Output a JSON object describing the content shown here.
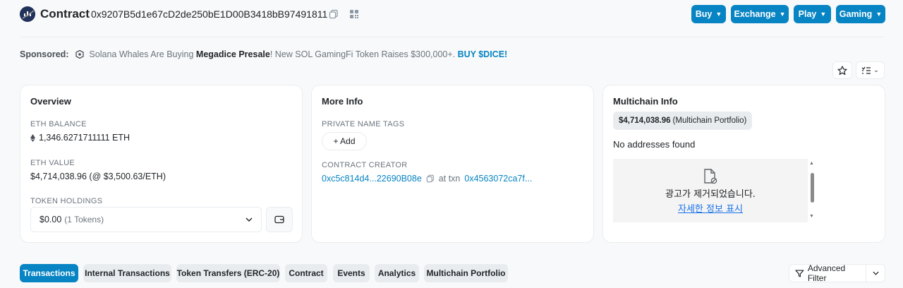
{
  "header": {
    "title": "Contract",
    "address": "0x9207B5d1e67cD2de250bE1D00B3418bB97491811",
    "buttons": [
      {
        "label": "Buy"
      },
      {
        "label": "Exchange"
      },
      {
        "label": "Play"
      },
      {
        "label": "Gaming"
      }
    ]
  },
  "sponsored": {
    "label": "Sponsored:",
    "text_before": "Solana Whales Are Buying ",
    "text_bold": "Megadice Presale",
    "text_after": "! New SOL GamingFi Token Raises $300,000+. ",
    "cta": "BUY $DICE!"
  },
  "overview": {
    "title": "Overview",
    "eth_balance_label": "ETH BALANCE",
    "eth_balance_value": "1,346.6271711111 ETH",
    "eth_value_label": "ETH VALUE",
    "eth_value_value": "$4,714,038.96 (@ $3,500.63/ETH)",
    "token_holdings_label": "TOKEN HOLDINGS",
    "token_holdings_value": "$0.00",
    "token_holdings_count": "(1 Tokens)"
  },
  "more_info": {
    "title": "More Info",
    "private_tags_label": "PRIVATE NAME TAGS",
    "add_label": "+ Add",
    "creator_label": "CONTRACT CREATOR",
    "creator_address": "0xc5c814d4...22690B08e",
    "at_txn_label": "at txn",
    "txn_hash": "0x4563072ca7f..."
  },
  "multichain": {
    "title": "Multichain Info",
    "portfolio_value": "$4,714,038.96",
    "portfolio_label": "(Multichain Portfolio)",
    "no_addresses": "No addresses found",
    "ad_removed": "광고가 제거되었습니다.",
    "ad_details_link": "자세한 정보 표시"
  },
  "tabs": [
    {
      "label": "Transactions",
      "active": true
    },
    {
      "label": "Internal Transactions"
    },
    {
      "label": "Token Transfers (ERC-20)"
    },
    {
      "label": "Contract"
    },
    {
      "label": "Events"
    },
    {
      "label": "Analytics"
    },
    {
      "label": "Multichain Portfolio"
    }
  ],
  "advanced_filter": {
    "label": "Advanced Filter"
  },
  "colors": {
    "accent": "#0784c3",
    "dark_navy": "#21325b"
  },
  "icons": [
    "etherscan-logo-icon",
    "copy-icon",
    "qr-code-icon",
    "chevron-down-icon",
    "sponsor-icon",
    "star-icon",
    "list-filter-icon",
    "ethereum-icon",
    "wallet-icon",
    "ad-removed-icon",
    "filter-icon"
  ]
}
